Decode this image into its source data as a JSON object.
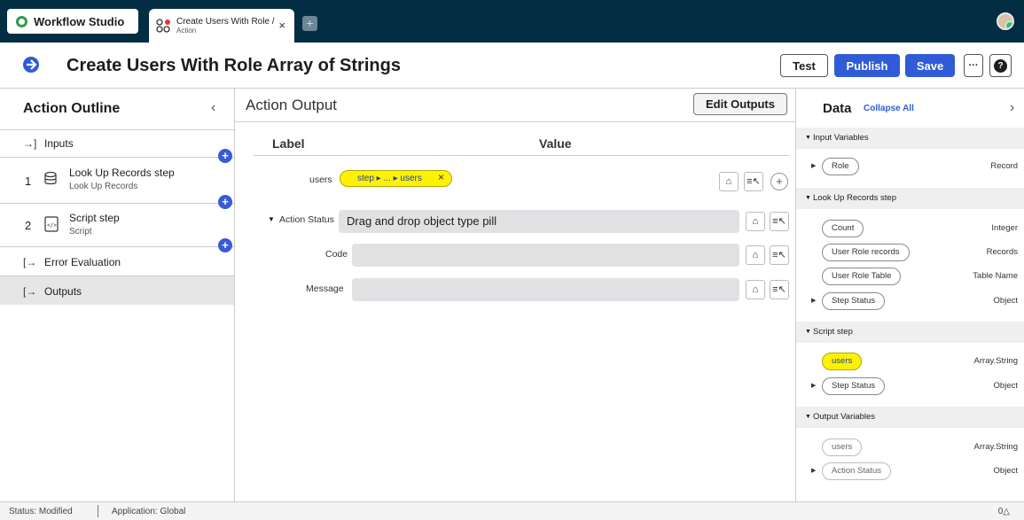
{
  "topbar": {
    "app_name": "Workflow Studio",
    "tab": {
      "title": "Create Users With Role /",
      "subtitle": "Action",
      "close": "×"
    },
    "add_tab": "+"
  },
  "header": {
    "title": "Create Users With Role Array of Strings",
    "buttons": {
      "test": "Test",
      "publish": "Publish",
      "save": "Save",
      "more": "···",
      "help": "?"
    }
  },
  "outline": {
    "title": "Action Outline",
    "collapse": "‹",
    "inputs": "Inputs",
    "steps": [
      {
        "number": "1",
        "label": "Look Up Records step",
        "sub": "Look Up Records"
      },
      {
        "number": "2",
        "label": "Script step",
        "sub": "Script"
      }
    ],
    "error_evaluation": "Error Evaluation",
    "outputs": "Outputs"
  },
  "action_output": {
    "title": "Action Output",
    "edit_button": "Edit Outputs",
    "columns": {
      "label": "Label",
      "value": "Value"
    },
    "rows": {
      "users": {
        "label": "users",
        "pill": "step ▸ ... ▸ users",
        "pill_close": "×"
      },
      "action_status": {
        "label": "Action Status",
        "value": "Drag and drop object type pill"
      },
      "code": {
        "label": "Code",
        "value": ""
      },
      "message": {
        "label": "Message",
        "value": ""
      }
    }
  },
  "data_panel": {
    "title": "Data",
    "collapse_all": "Collapse All",
    "chevron": "›",
    "sections": {
      "input_variables": {
        "title": "Input Variables",
        "items": [
          {
            "name": "Role",
            "type": "Record",
            "expandable": true
          }
        ]
      },
      "look_up_records": {
        "title": "Look Up Records step",
        "items": [
          {
            "name": "Count",
            "type": "Integer",
            "expandable": false
          },
          {
            "name": "User Role records",
            "type": "Records",
            "expandable": false
          },
          {
            "name": "User Role Table",
            "type": "Table Name",
            "expandable": false
          },
          {
            "name": "Step Status",
            "type": "Object",
            "expandable": true
          }
        ]
      },
      "script_step": {
        "title": "Script step",
        "items": [
          {
            "name": "users",
            "type": "Array.String",
            "expandable": false,
            "highlighted": true
          },
          {
            "name": "Step Status",
            "type": "Object",
            "expandable": true
          }
        ]
      },
      "output_variables": {
        "title": "Output Variables",
        "items": [
          {
            "name": "users",
            "type": "Array.String",
            "expandable": false
          },
          {
            "name": "Action Status",
            "type": "Object",
            "expandable": true
          }
        ]
      }
    }
  },
  "statusbar": {
    "status": "Status: Modified",
    "application": "Application: Global",
    "alerts": "0△"
  },
  "colors": {
    "topbar": "#032d42",
    "primary": "#2f5bd6",
    "pill_highlight": "#fff200",
    "outline_node": "#3a5bd8"
  }
}
